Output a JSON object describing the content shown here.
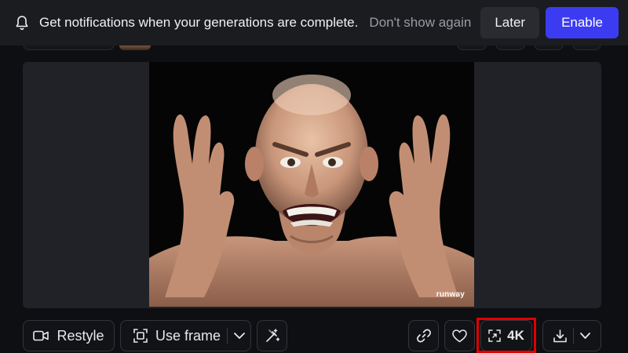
{
  "banner": {
    "message": "Get notifications when your generations are complete.",
    "dont_show": "Don't show again",
    "later": "Later",
    "enable": "Enable",
    "icon": "bell-icon",
    "colors": {
      "background": "#1b1c20",
      "enable": "#3b3cf2"
    }
  },
  "preview": {
    "watermark": "runway"
  },
  "toolbar": {
    "restyle_label": "Restyle",
    "use_frame_label": "Use frame",
    "upscale_label": "4K",
    "icons": [
      "video-camera-icon",
      "frame-capture-icon",
      "chevron-down-icon",
      "magic-wand-icon",
      "link-icon",
      "heart-icon",
      "upscale-icon",
      "download-icon",
      "chevron-down-icon"
    ],
    "highlight_color": "#e00000"
  }
}
